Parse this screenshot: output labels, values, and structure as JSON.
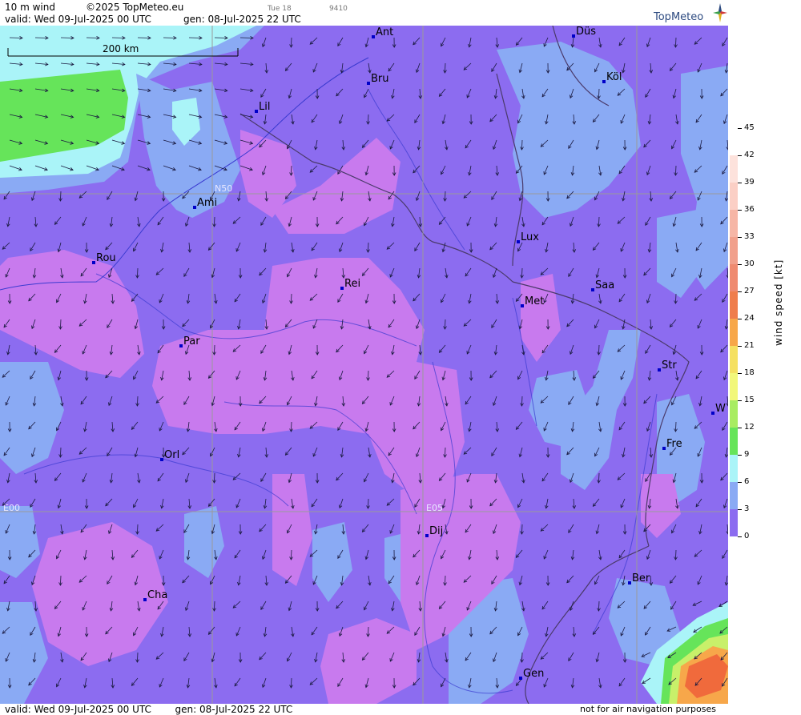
{
  "header": {
    "title": "10 m wind",
    "copyright": "©2025 TopMeteo.eu",
    "small_time": "Tue 18",
    "small_code": "9410",
    "valid": "valid:  Wed  09-Jul-2025  00 UTC",
    "gen": "gen: 08-Jul-2025 22 UTC",
    "logo": "TopMeteo"
  },
  "map": {
    "scale_label": "200 km",
    "grid_labels": [
      "N50",
      "E00",
      "E05"
    ],
    "cities": [
      "Ant",
      "Düs",
      "Bru",
      "Köl",
      "Lil",
      "Ami",
      "Lux",
      "Rou",
      "Rei",
      "Saa",
      "Met",
      "Par",
      "Str",
      "W",
      "Fre",
      "Orl",
      "Dij",
      "Ber",
      "Cha",
      "Gen"
    ],
    "colors": {
      "speed_0_3": "#c87aee",
      "speed_3_6": "#8c6cf0",
      "speed_6_9": "#8aaaf4",
      "speed_9_12": "#aaf4f8",
      "speed_12_15": "#66e45a",
      "speed_15_18": "#c8f06a",
      "speed_high": "#f06a3c"
    }
  },
  "legend": {
    "title": "wind  speed  [kt]",
    "ticks": [
      "45",
      "42",
      "39",
      "36",
      "33",
      "30",
      "27",
      "24",
      "21",
      "18",
      "15",
      "12",
      "9",
      "6",
      "3",
      "0"
    ],
    "colors": [
      "#fff4f0",
      "#fde2dc",
      "#fbcfc5",
      "#f6b6a6",
      "#f1a08c",
      "#ef8a70",
      "#ef7d4c",
      "#f7a74a",
      "#f5e062",
      "#f2f77a",
      "#a8ec62",
      "#66e45a",
      "#aaf4f8",
      "#8aaaf4",
      "#8c6cf0",
      "#c87aee"
    ]
  },
  "footer": {
    "valid": "valid:  Wed  09-Jul-2025  00 UTC",
    "gen": "gen: 08-Jul-2025 22 UTC",
    "note": "not for air navigation purposes"
  }
}
